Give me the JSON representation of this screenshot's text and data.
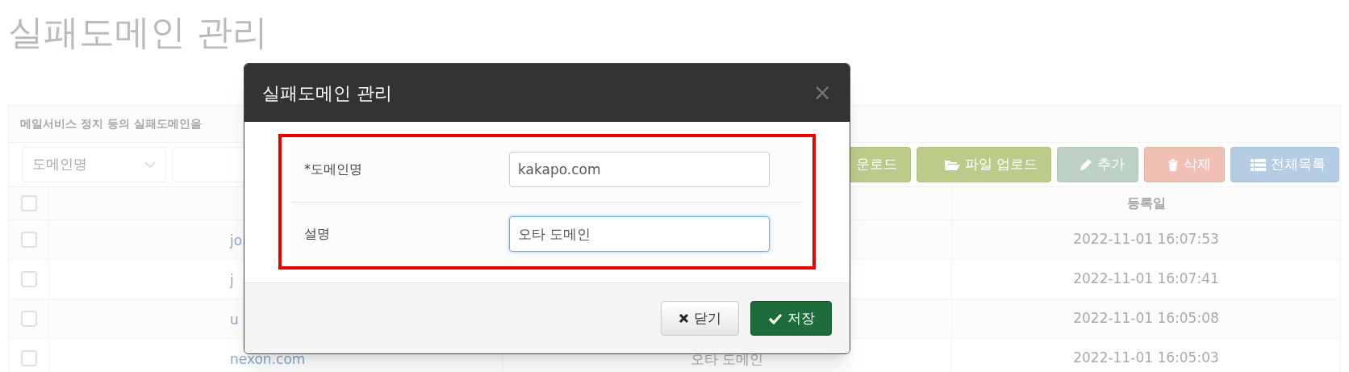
{
  "page_title": "실패도메인 관리",
  "panel": {
    "heading": "메일서비스 정지 등의 실패도메인을",
    "filter": {
      "select": "도메인명"
    },
    "toolbar_buttons": [
      {
        "kind": "download",
        "label": "운로드"
      },
      {
        "kind": "upload",
        "label": "파일 업로드"
      },
      {
        "kind": "add",
        "label": "추가"
      },
      {
        "kind": "delete",
        "label": "삭제"
      },
      {
        "kind": "list",
        "label": "전체목록"
      }
    ],
    "table": {
      "header_checked": false,
      "columns": [
        "등록일"
      ],
      "rows": [
        {
          "checked": false,
          "domain": "jo",
          "registered": "2022-11-01 16:07:53"
        },
        {
          "checked": false,
          "domain": "j",
          "registered": "2022-11-01 16:07:41"
        },
        {
          "checked": false,
          "domain": "u",
          "registered": "2022-11-01 16:05:08"
        },
        {
          "checked": false,
          "domain": "nexon.com",
          "description": "오타 도메인",
          "registered": "2022-11-01 16:05:03"
        }
      ]
    }
  },
  "modal": {
    "title": "실패도메인 관리",
    "close": "×",
    "highlighted": true,
    "fields": [
      {
        "label": "*도메인명",
        "value": "kakapo.com",
        "focused": false
      },
      {
        "label": "설명",
        "value": "오타 도메인",
        "focused": true
      }
    ],
    "buttons": [
      {
        "kind": "close",
        "label": "닫기"
      },
      {
        "kind": "save",
        "label": "저장"
      }
    ]
  }
}
